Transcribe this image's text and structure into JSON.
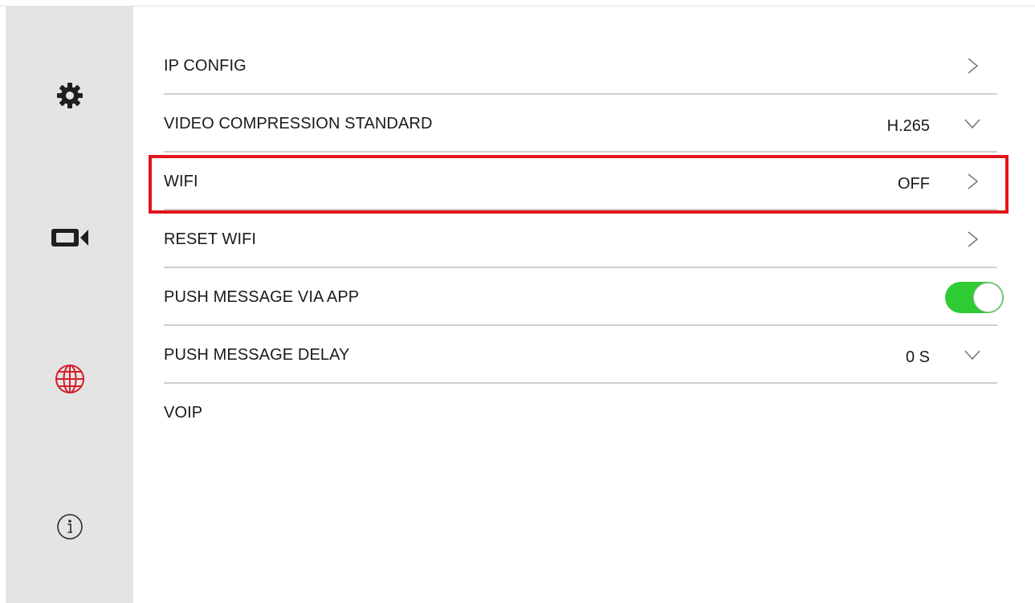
{
  "sidebar": {
    "items": [
      {
        "icon": "gear-icon",
        "color": "#1f1f1f"
      },
      {
        "icon": "video-camera-icon",
        "color": "#1f1f1f"
      },
      {
        "icon": "globe-icon",
        "color": "#d2202a",
        "active": true
      },
      {
        "icon": "info-icon",
        "color": "#2a2a2a"
      }
    ]
  },
  "settings": {
    "rows": [
      {
        "label": "IP CONFIG",
        "value": "",
        "control": "chevron-right"
      },
      {
        "label": "VIDEO COMPRESSION STANDARD",
        "value": "H.265",
        "control": "chevron-down"
      },
      {
        "label": "WIFI",
        "value": "OFF",
        "control": "chevron-right",
        "highlighted": true
      },
      {
        "label": "RESET WIFI",
        "value": "",
        "control": "chevron-right"
      },
      {
        "label": "PUSH MESSAGE VIA APP",
        "value": "",
        "control": "toggle",
        "toggle_on": true
      },
      {
        "label": "PUSH MESSAGE DELAY",
        "value": "0 S",
        "control": "chevron-down"
      },
      {
        "label": "VOIP",
        "value": "",
        "control": "none"
      }
    ]
  },
  "colors": {
    "sidebar_bg": "#e4e4e4",
    "divider": "#cfcfcf",
    "toggle_on": "#2ecb32",
    "highlight_border": "#e3141b",
    "active_icon": "#d2202a"
  }
}
